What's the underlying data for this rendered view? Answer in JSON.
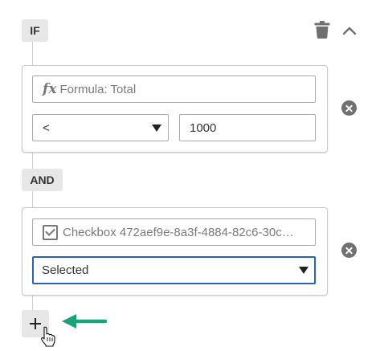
{
  "group": {
    "if_label": "IF",
    "and_label": "AND",
    "actions": {
      "delete_icon": "trash-icon",
      "collapse_icon": "chevron-up-icon"
    }
  },
  "conditions": [
    {
      "field_icon": "fx-icon",
      "field_placeholder": "Formula: Total",
      "operator": "<",
      "value": "1000",
      "remove_icon": "close-circle-icon"
    },
    {
      "field_icon": "checkbox-icon",
      "field_placeholder": "Checkbox 472aef9e-8a3f-4884-82c6-30c…",
      "operator": "Selected",
      "remove_icon": "close-circle-icon"
    }
  ],
  "add_button": {
    "icon": "plus-icon"
  },
  "annotation": {
    "arrow_color": "#1aa37a"
  },
  "colors": {
    "focus_border": "#2a62b8",
    "tag_bg": "#e7e7e7"
  }
}
